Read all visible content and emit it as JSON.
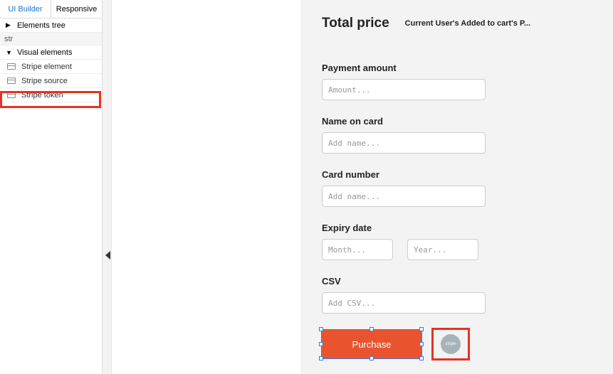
{
  "sidebar": {
    "tabs": [
      {
        "label": "UI Builder",
        "active": true
      },
      {
        "label": "Responsive",
        "active": false
      }
    ],
    "elements_tree_label": "Elements tree",
    "search_value": "str",
    "visual_elements_label": "Visual elements",
    "items": [
      {
        "label": "Stripe element"
      },
      {
        "label": "Stripe source"
      },
      {
        "label": "Stripe token"
      }
    ]
  },
  "form": {
    "title": "Total price",
    "subtitle": "Current User's Added to cart's P...",
    "payment_amount": {
      "label": "Payment amount",
      "placeholder": "Amount..."
    },
    "name_on_card": {
      "label": "Name on card",
      "placeholder": "Add name..."
    },
    "card_number": {
      "label": "Card number",
      "placeholder": "Add name..."
    },
    "expiry": {
      "label": "Expiry date",
      "month_placeholder": "Month...",
      "year_placeholder": "Year..."
    },
    "csv": {
      "label": "CSV",
      "placeholder": "Add CSV..."
    },
    "purchase_label": "Purchase",
    "stripe_badge_text": "stripe"
  }
}
